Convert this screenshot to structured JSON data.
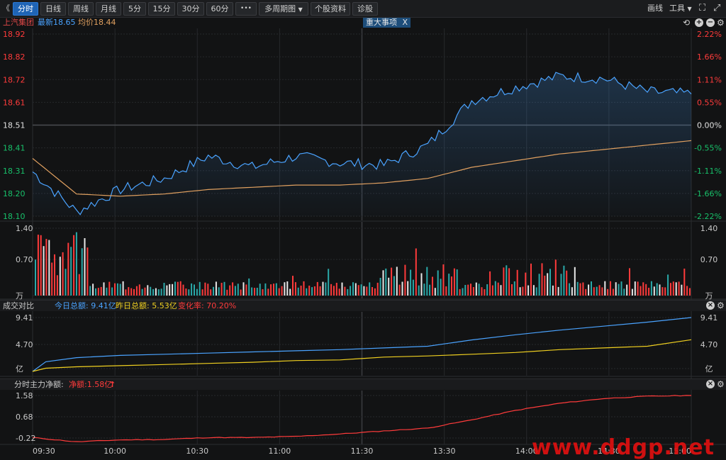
{
  "toolbar": {
    "back": "《",
    "tabs": [
      "分时",
      "日线",
      "周线",
      "月线",
      "5分",
      "15分",
      "30分",
      "60分"
    ],
    "more": "•••",
    "multi_period": "多周期图",
    "stock_info": "个股资料",
    "diagnose": "诊股",
    "draw_line": "画线",
    "tools": "工具",
    "expand_icon": "expand-icon",
    "back_icon": "double-left-chevron-icon"
  },
  "info": {
    "name": "上汽集团",
    "latest": "最新18.65",
    "avg": "均价18.44",
    "event_label": "重大事项",
    "event_close": "X"
  },
  "price_axis": {
    "left": [
      "18.92",
      "18.82",
      "18.72",
      "18.61",
      "18.51",
      "18.41",
      "18.31",
      "18.20",
      "18.10"
    ],
    "right": [
      "2.22%",
      "1.66%",
      "1.11%",
      "0.55%",
      "0.00%",
      "-0.55%",
      "-1.11%",
      "-1.66%",
      "-2.22%"
    ]
  },
  "volume_axis": {
    "ticks": [
      "1.40",
      "0.70",
      "万"
    ]
  },
  "turnover": {
    "title": "成交对比",
    "today": "今日总额: 9.41亿",
    "yesterday": "昨日总额: 5.53亿",
    "change": "变化率: 70.20%",
    "ticks": [
      "9.41",
      "4.70",
      "亿"
    ]
  },
  "mainforce": {
    "title": "分时主力净额:",
    "net": "净额:1.58亿",
    "arrow": "↑",
    "ticks": [
      "1.58",
      "0.68",
      "-0.22"
    ]
  },
  "time_axis": [
    "09:30",
    "10:00",
    "10:30",
    "11:00",
    "11:30",
    "13:30",
    "14:00",
    "14:30",
    "15:00"
  ],
  "watermark": "www.ddgp.net",
  "colors": {
    "up": "#ff3b3b",
    "down": "#18c06a",
    "price_line": "#4aa3ff",
    "avg_line": "#e0a060",
    "today_line": "#4aa3ff",
    "yesterday_line": "#f0d020",
    "mainforce_line": "#ff3b3b",
    "volume_teal": "#2aa9a9"
  },
  "chart_data": [
    {
      "type": "line",
      "title": "",
      "x": [
        "09:30",
        "09:45",
        "10:00",
        "10:15",
        "10:30",
        "10:45",
        "11:00",
        "11:15",
        "11:30",
        "13:30",
        "13:45",
        "14:00",
        "14:15",
        "14:30",
        "14:45",
        "15:00"
      ],
      "series": [
        {
          "name": "最新",
          "values": [
            18.3,
            18.12,
            18.22,
            18.27,
            18.37,
            18.32,
            18.37,
            18.34,
            18.33,
            18.42,
            18.62,
            18.68,
            18.73,
            18.72,
            18.66,
            18.65
          ]
        },
        {
          "name": "均价",
          "values": [
            18.36,
            18.2,
            18.19,
            18.2,
            18.22,
            18.23,
            18.24,
            18.24,
            18.25,
            18.27,
            18.32,
            18.35,
            18.38,
            18.4,
            18.42,
            18.44
          ]
        }
      ],
      "ylim": [
        18.1,
        18.92
      ],
      "grid": true
    },
    {
      "type": "bar",
      "ylim": [
        0,
        1.4
      ],
      "unit": "万"
    },
    {
      "type": "line",
      "series": [
        {
          "name": "今日总额",
          "values": [
            0,
            2.4,
            2.8,
            3.0,
            3.2,
            3.4,
            3.6,
            3.8,
            4.1,
            4.4,
            5.5,
            6.4,
            7.2,
            7.9,
            8.6,
            9.41
          ]
        },
        {
          "name": "昨日总额",
          "values": [
            0,
            0.8,
            1.0,
            1.2,
            1.4,
            1.6,
            1.9,
            2.0,
            2.5,
            2.7,
            3.0,
            3.3,
            3.8,
            4.1,
            4.4,
            5.53
          ]
        }
      ],
      "ylim": [
        0,
        9.41
      ],
      "unit": "亿"
    },
    {
      "type": "line",
      "series": [
        {
          "name": "净额",
          "values": [
            -0.2,
            -0.38,
            -0.3,
            -0.28,
            -0.2,
            -0.2,
            -0.15,
            -0.05,
            0.08,
            0.2,
            0.55,
            0.95,
            1.25,
            1.45,
            1.55,
            1.58
          ]
        }
      ],
      "ylim": [
        -0.4,
        1.58
      ]
    }
  ]
}
